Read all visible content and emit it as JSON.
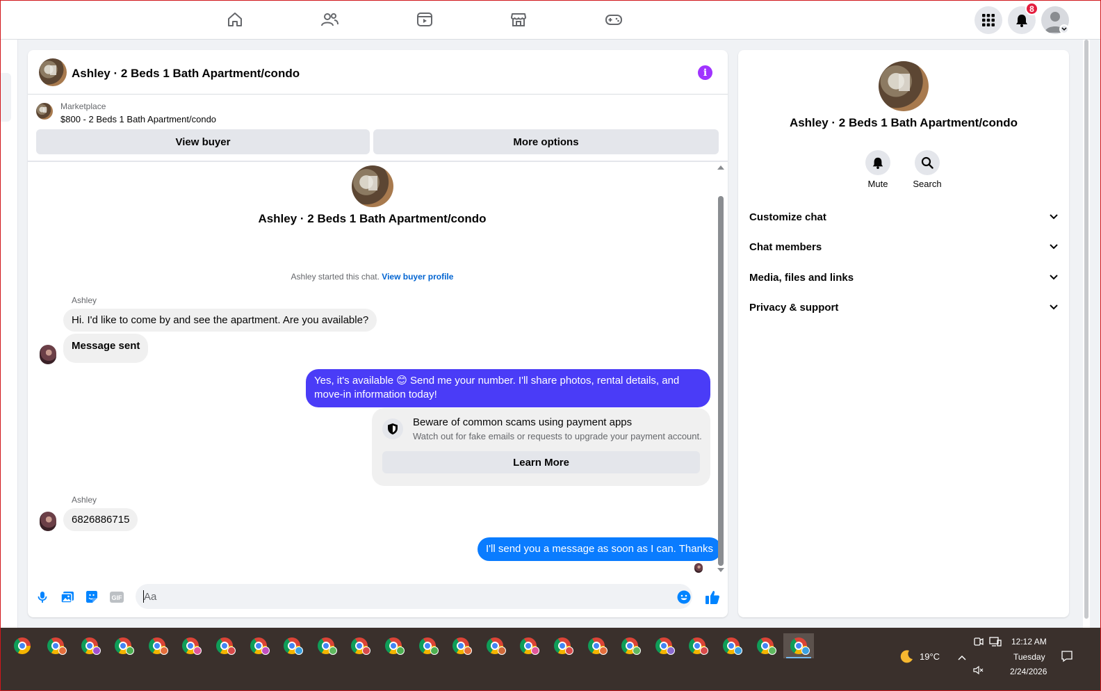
{
  "top_nav": {
    "icons": [
      "home-icon",
      "friends-icon",
      "video-icon",
      "marketplace-icon",
      "gaming-icon"
    ],
    "notification_count": "8"
  },
  "chat": {
    "header_title": "Ashley · 2 Beds 1 Bath Apartment/condo",
    "marketplace_label": "Marketplace",
    "listing": "$800 - 2 Beds 1 Bath Apartment/condo",
    "view_buyer_label": "View buyer",
    "more_options_label": "More options",
    "center_title": "Ashley · 2 Beds 1 Bath Apartment/condo",
    "started_text": "Ashley started this chat.",
    "view_profile_link": "View buyer profile",
    "messages": [
      {
        "sender": "Ashley",
        "text": "Hi. I'd like to come by and see the apartment. Are you available?"
      },
      {
        "text": "Message sent"
      },
      {
        "text": "Yes, it's available 😊 Send me your number. I'll share photos, rental details, and move-in information today!"
      },
      {
        "sender": "Ashley",
        "text": "6826886715"
      },
      {
        "text": "I'll send you a message as soon as I can. Thanks"
      }
    ],
    "scam_notice": {
      "title": "Beware of common scams using payment apps",
      "subtitle": "Watch out for fake emails or requests to upgrade your payment account.",
      "button": "Learn More"
    },
    "composer": {
      "placeholder": "Aa"
    }
  },
  "info_panel": {
    "title": "Ashley · 2 Beds 1 Bath Apartment/condo",
    "actions": [
      {
        "label": "Mute",
        "icon": "bell-icon"
      },
      {
        "label": "Search",
        "icon": "search-icon"
      }
    ],
    "sections": [
      "Customize chat",
      "Chat members",
      "Media, files and links",
      "Privacy & support"
    ]
  },
  "taskbar": {
    "weather_temp": "19°C",
    "time": "12:12 AM",
    "day": "Tuesday",
    "date": "2/24/2026",
    "profile_colors": [
      "#e46e3c",
      "#a04fd0",
      "#4caf50",
      "#e46e3c",
      "#e0569a",
      "#d84a4a",
      "#c04fc0",
      "#3aa0e0",
      "#5fb85f",
      "#d84a4a",
      "#4caf50",
      "#4caf50",
      "#e46e3c",
      "#d06a3a",
      "#e0569a",
      "#d84a4a",
      "#e46e3c",
      "#5fb85f",
      "#8a6ad0",
      "#d84a4a",
      "#3aa0e0",
      "#5fb85f",
      "#3aa0e0"
    ],
    "colors": {
      "taskbar": "#3a302c",
      "accent": "#0084ff",
      "purple_bubble": "#4a3cf7",
      "blue_bubble": "#0a7cff"
    }
  }
}
